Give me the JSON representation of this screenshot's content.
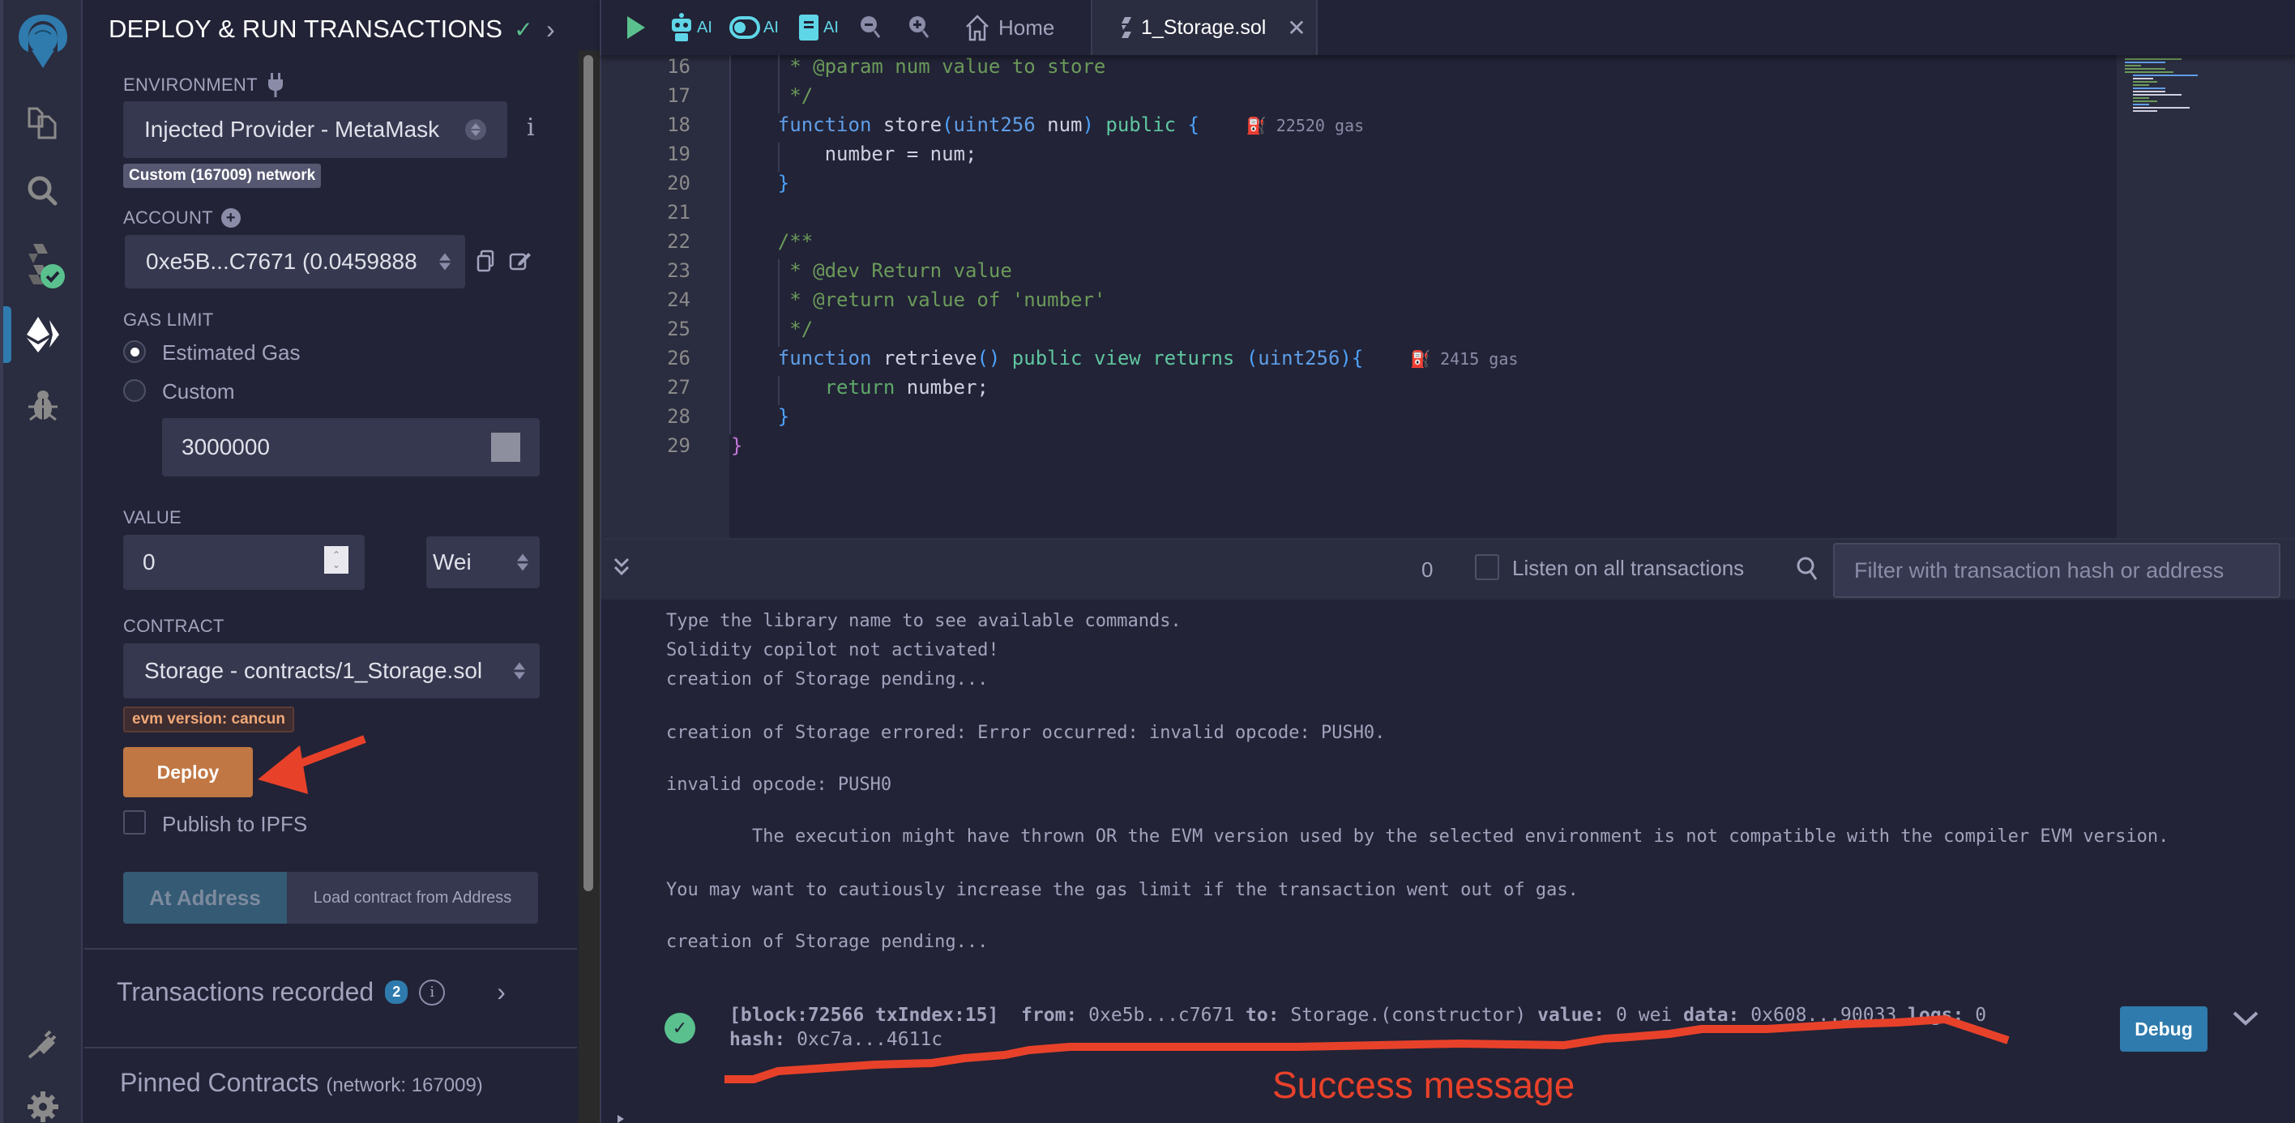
{
  "iconbar": {
    "items": [
      {
        "name": "remix-logo",
        "label": "Remix"
      },
      {
        "name": "file-explorer",
        "label": "File explorer"
      },
      {
        "name": "search",
        "label": "Search"
      },
      {
        "name": "solidity-compiler",
        "label": "Solidity compiler",
        "status": "success"
      },
      {
        "name": "deploy-run",
        "label": "Deploy & run transactions",
        "active": true
      },
      {
        "name": "debugger",
        "label": "Debugger"
      },
      {
        "name": "plugin-manager",
        "label": "Plugin manager"
      },
      {
        "name": "settings",
        "label": "Settings"
      }
    ]
  },
  "panel": {
    "title": "DEPLOY & RUN TRANSACTIONS",
    "environment": {
      "label": "ENVIRONMENT",
      "value": "Injected Provider - MetaMask",
      "network_badge": "Custom (167009) network"
    },
    "account": {
      "label": "ACCOUNT",
      "value": "0xe5B...C7671 (0.0459888"
    },
    "gas_limit": {
      "label": "GAS LIMIT",
      "options": [
        {
          "label": "Estimated Gas",
          "selected": true
        },
        {
          "label": "Custom",
          "selected": false
        }
      ],
      "custom_value": "3000000"
    },
    "value": {
      "label": "VALUE",
      "amount": "0",
      "unit": "Wei"
    },
    "contract": {
      "label": "CONTRACT",
      "value": "Storage - contracts/1_Storage.sol",
      "evm_badge": "evm version: cancun"
    },
    "deploy_label": "Deploy",
    "publish_ipfs_label": "Publish to IPFS",
    "publish_ipfs_checked": false,
    "at_address_label": "At Address",
    "load_address_label": "Load contract from Address",
    "transactions_recorded": {
      "label": "Transactions recorded",
      "count": "2"
    },
    "pinned": {
      "label": "Pinned Contracts",
      "network": "(network: 167009)"
    }
  },
  "tabs": {
    "ai_label": "AI",
    "home": "Home",
    "file": "1_Storage.sol",
    "close": "✕"
  },
  "editor": {
    "lines": [
      {
        "n": "16",
        "text": "     * @param num value to store"
      },
      {
        "n": "17",
        "text": "     */"
      },
      {
        "n": "18",
        "text": "    function store(uint256 num) public {"
      },
      {
        "n": "19",
        "text": "        number = num;"
      },
      {
        "n": "20",
        "text": "    }"
      },
      {
        "n": "21",
        "text": ""
      },
      {
        "n": "22",
        "text": "    /**"
      },
      {
        "n": "23",
        "text": "     * @dev Return value"
      },
      {
        "n": "24",
        "text": "     * @return value of 'number'"
      },
      {
        "n": "25",
        "text": "     */"
      },
      {
        "n": "26",
        "text": "    function retrieve() public view returns (uint256){"
      },
      {
        "n": "27",
        "text": "        return number;"
      },
      {
        "n": "28",
        "text": "    }"
      },
      {
        "n": "29",
        "text": "}"
      }
    ],
    "gas_hints": {
      "store": "22520 gas",
      "retrieve": "2415 gas"
    }
  },
  "terminal": {
    "tx_count": "0",
    "listen_label": "Listen on all transactions",
    "filter_placeholder": "Filter with transaction hash or address",
    "logs": [
      "Type the library name to see available commands.",
      "Solidity copilot not activated!",
      "creation of Storage pending...",
      "creation of Storage errored: Error occurred: invalid opcode: PUSH0.",
      "invalid opcode: PUSH0",
      "        The execution might have thrown OR the EVM version used by the selected environment is not compatible with the compiler EVM version.",
      "You may want to cautiously increase the gas limit if the transaction went out of gas.",
      "creation of Storage pending..."
    ],
    "tx": {
      "block": "[block:72566 txIndex:15]",
      "from_label": "from:",
      "from": "0xe5b...c7671",
      "to_label": "to:",
      "to": "Storage.(constructor)",
      "value_label": "value:",
      "value": "0 wei",
      "data_label": "data:",
      "data": "0x608...90033",
      "logs_label": "logs:",
      "logs": "0",
      "hash_label": "hash:",
      "hash": "0xc7a...4611c"
    },
    "debug_label": "Debug"
  },
  "annotations": {
    "success_label": "Success message",
    "color": "#e8412a"
  }
}
